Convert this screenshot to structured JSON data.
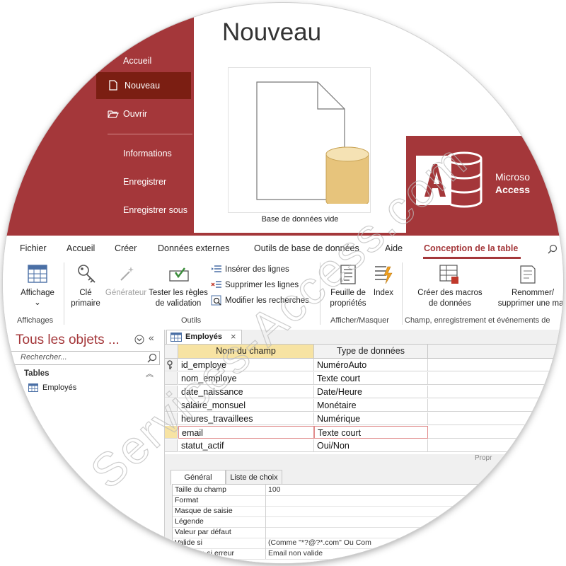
{
  "backstage": {
    "title": "Nouveau",
    "menu": [
      {
        "label": "Accueil"
      },
      {
        "label": "Nouveau",
        "active": true
      },
      {
        "label": "Ouvrir"
      },
      {
        "label": "Informations"
      },
      {
        "label": "Enregistrer"
      },
      {
        "label": "Enregistrer sous"
      }
    ],
    "template_caption": "Base de données vide",
    "promo": {
      "line1": "Microso",
      "line2": "Access"
    }
  },
  "ribbon": {
    "tabs": [
      "Fichier",
      "Accueil",
      "Créer",
      "Données externes",
      "Outils de base de données",
      "Aide",
      "Conception de la table"
    ],
    "active_tab": "Conception de la table",
    "buttons": {
      "affichage": "Affichage",
      "cle_primaire_1": "Clé",
      "cle_primaire_2": "primaire",
      "generateur": "Générateur",
      "tester_1": "Tester les règles",
      "tester_2": "de validation",
      "inserer": "Insérer des lignes",
      "supprimer": "Supprimer les lignes",
      "modifier": "Modifier les recherches",
      "feuille_1": "Feuille de",
      "feuille_2": "propriétés",
      "index": "Index",
      "macros_1": "Créer des macros",
      "macros_2": "de données",
      "renommer_1": "Renommer/",
      "renommer_2": "supprimer une mac"
    },
    "groups": {
      "affichages": "Affichages",
      "outils": "Outils",
      "afficher_masquer": "Afficher/Masquer",
      "champ": "Champ, enregistrement et événements de"
    }
  },
  "nav": {
    "title": "Tous les objets ...",
    "search_placeholder": "Rechercher...",
    "section": "Tables",
    "item": "Employés"
  },
  "document": {
    "tab_label": "Employés",
    "columns": [
      "Nom du champ",
      "Type de données"
    ],
    "rows": [
      {
        "name": "id_employe",
        "type": "NuméroAuto",
        "primary": true
      },
      {
        "name": "nom_employe",
        "type": "Texte court"
      },
      {
        "name": "date_naissance",
        "type": "Date/Heure"
      },
      {
        "name": "salaire_monsuel",
        "type": "Monétaire"
      },
      {
        "name": "heures_travaillees",
        "type": "Numérique"
      },
      {
        "name": "email",
        "type": "Texte court",
        "current": true
      },
      {
        "name": "statut_actif",
        "type": "Oui/Non"
      }
    ],
    "properties_label": "Propr",
    "prop_tabs": [
      "Général",
      "Liste de choix"
    ],
    "properties": [
      {
        "name": "Taille du champ",
        "value": "100"
      },
      {
        "name": "Format",
        "value": ""
      },
      {
        "name": "Masque de saisie",
        "value": ""
      },
      {
        "name": "Légende",
        "value": ""
      },
      {
        "name": "Valeur par défaut",
        "value": ""
      },
      {
        "name": "Valide si",
        "value": "(Comme \"*?@?*.com\" Ou Com"
      },
      {
        "name": "Message si erreur",
        "value": "Email non valide"
      }
    ]
  },
  "watermark": "Services-Access.com",
  "colors": {
    "accent": "#a4373a",
    "accent_dark": "#7b1e12",
    "db_gold": "#e7c47c"
  }
}
